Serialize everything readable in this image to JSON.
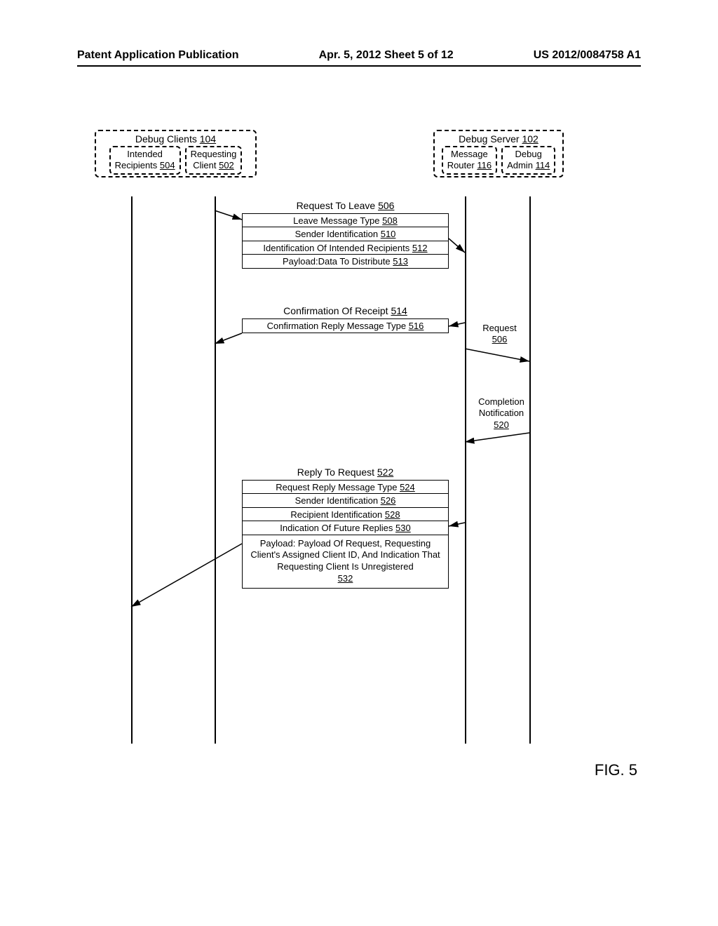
{
  "header": {
    "left": "Patent Application Publication",
    "center": "Apr. 5, 2012  Sheet 5 of 12",
    "right": "US 2012/0084758 A1"
  },
  "figure_label": "FIG. 5",
  "left_group": {
    "title": "Debug Clients",
    "title_ref": "104",
    "sub": {
      "recipients": {
        "l1": "Intended",
        "l2": "Recipients",
        "ref": "504"
      },
      "requesting": {
        "l1": "Requesting",
        "l2": "Client",
        "ref": "502"
      }
    }
  },
  "right_group": {
    "title": "Debug Server",
    "title_ref": "102",
    "sub": {
      "router": {
        "l1": "Message",
        "l2": "Router",
        "ref": "116"
      },
      "admin": {
        "l1": "Debug",
        "l2": "Admin",
        "ref": "114"
      }
    }
  },
  "msg1": {
    "title": "Request To Leave",
    "title_ref": "506",
    "rows": [
      {
        "text": "Leave Message Type",
        "ref": "508"
      },
      {
        "text": "Sender Identification",
        "ref": "510"
      },
      {
        "text": "Identification Of Intended Recipients",
        "ref": "512"
      },
      {
        "text": "Payload:Data To Distribute",
        "ref": "513"
      }
    ]
  },
  "msg2": {
    "title": "Confirmation Of Receipt",
    "title_ref": "514",
    "rows": [
      {
        "text": "Confirmation Reply Message Type",
        "ref": "516"
      }
    ]
  },
  "side": {
    "request": {
      "text": "Request",
      "ref": "506"
    },
    "completion": {
      "l1": "Completion",
      "l2": "Notification",
      "ref": "520"
    }
  },
  "msg3": {
    "title": "Reply To Request",
    "title_ref": "522",
    "rows": [
      {
        "text": "Request Reply Message Type",
        "ref": "524"
      },
      {
        "text": "Sender Identification",
        "ref": "526"
      },
      {
        "text": "Recipient Identification",
        "ref": "528"
      },
      {
        "text": "Indication Of Future Replies",
        "ref": "530"
      }
    ],
    "payload_row": {
      "text": "Payload: Payload Of Request, Requesting Client's Assigned Client ID, And Indication That Requesting Client Is Unregistered",
      "ref": "532"
    }
  }
}
